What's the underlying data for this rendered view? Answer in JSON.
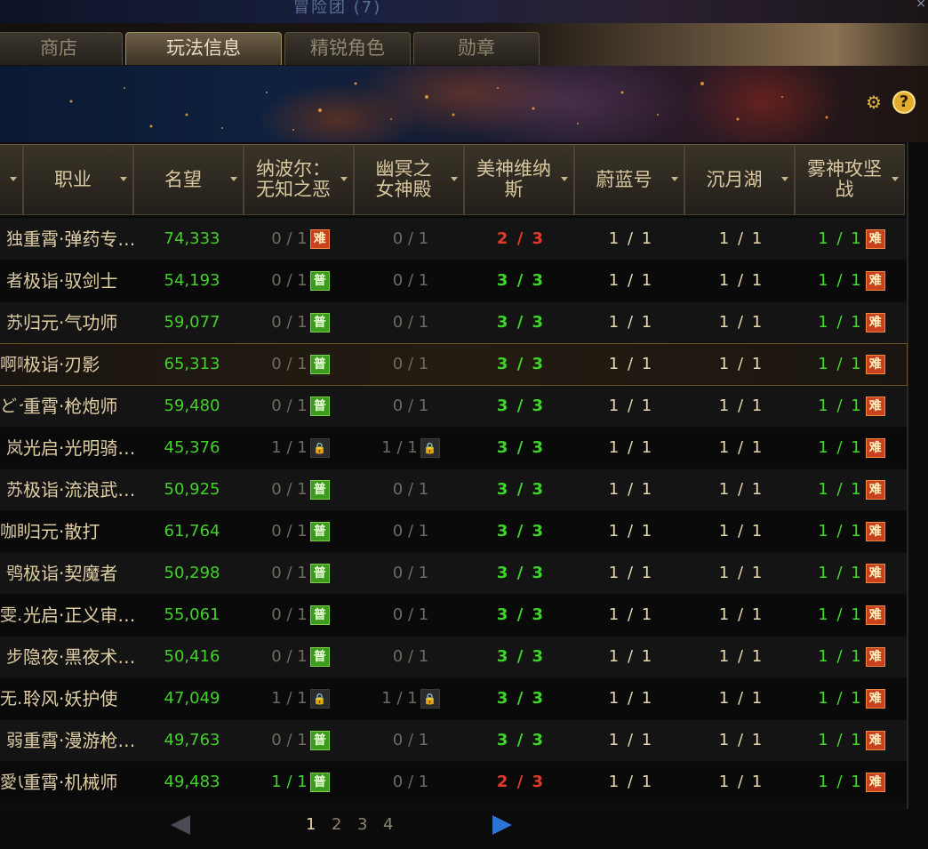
{
  "window": {
    "title": "冒险团 (7)",
    "close_glyph": "×"
  },
  "tabs": [
    {
      "label": "商店",
      "active": false
    },
    {
      "label": "玩法信息",
      "active": true
    },
    {
      "label": "精锐角色",
      "active": false
    },
    {
      "label": "勋章",
      "active": false
    }
  ],
  "toolbar": {
    "settings_icon": "gear-icon",
    "help_icon": "help-icon",
    "help_glyph": "?"
  },
  "table": {
    "headers": {
      "name": "",
      "job": "职业",
      "fame": "名望",
      "nabol": "纳波尔：\n无知之恶",
      "youming": "幽冥之\n女神殿",
      "meishen": "美神维纳\n斯",
      "weilan": "蔚蓝号",
      "chenyue": "沉月湖",
      "wushen": "雾神攻坚\n战"
    },
    "rows": [
      {
        "name": "独",
        "job": "重霄·弹药专…",
        "fame": "74,333",
        "nabol": "0 / 1",
        "nabol_badge": "难",
        "youming": "0 / 1",
        "youming_badge": "",
        "meishen": "2 / 3",
        "weilan": "1 / 1",
        "chenyue": "1 / 1",
        "wushen": "1 / 1",
        "wushen_badge": "难"
      },
      {
        "name": "者",
        "job": "极诣·驭剑士",
        "fame": "54,193",
        "nabol": "0 / 1",
        "nabol_badge": "普",
        "youming": "0 / 1",
        "youming_badge": "",
        "meishen": "3 / 3",
        "weilan": "1 / 1",
        "chenyue": "1 / 1",
        "wushen": "1 / 1",
        "wushen_badge": "难"
      },
      {
        "name": "苏",
        "job": "归元·气功师",
        "fame": "59,077",
        "nabol": "0 / 1",
        "nabol_badge": "普",
        "youming": "0 / 1",
        "youming_badge": "",
        "meishen": "3 / 3",
        "weilan": "1 / 1",
        "chenyue": "1 / 1",
        "wushen": "1 / 1",
        "wushen_badge": "难"
      },
      {
        "name": "啊啊",
        "job": "极诣·刃影",
        "fame": "65,313",
        "nabol": "0 / 1",
        "nabol_badge": "普",
        "youming": "0 / 1",
        "youming_badge": "",
        "meishen": "3 / 3",
        "weilan": "1 / 1",
        "chenyue": "1 / 1",
        "wushen": "1 / 1",
        "wushen_badge": "难"
      },
      {
        "name": "どっ",
        "job": "重霄·枪炮师",
        "fame": "59,480",
        "nabol": "0 / 1",
        "nabol_badge": "普",
        "youming": "0 / 1",
        "youming_badge": "",
        "meishen": "3 / 3",
        "weilan": "1 / 1",
        "chenyue": "1 / 1",
        "wushen": "1 / 1",
        "wushen_badge": "难"
      },
      {
        "name": "岚",
        "job": "光启·光明骑…",
        "fame": "45,376",
        "nabol": "1 / 1",
        "nabol_badge": "lock",
        "youming": "1 / 1",
        "youming_badge": "lock",
        "meishen": "3 / 3",
        "weilan": "1 / 1",
        "chenyue": "1 / 1",
        "wushen": "1 / 1",
        "wushen_badge": "难"
      },
      {
        "name": "苏",
        "job": "极诣·流浪武…",
        "fame": "50,925",
        "nabol": "0 / 1",
        "nabol_badge": "普",
        "youming": "0 / 1",
        "youming_badge": "",
        "meishen": "3 / 3",
        "weilan": "1 / 1",
        "chenyue": "1 / 1",
        "wushen": "1 / 1",
        "wushen_badge": "难"
      },
      {
        "name": "咖眸",
        "job": "归元·散打",
        "fame": "61,764",
        "nabol": "0 / 1",
        "nabol_badge": "普",
        "youming": "0 / 1",
        "youming_badge": "",
        "meishen": "3 / 3",
        "weilan": "1 / 1",
        "chenyue": "1 / 1",
        "wushen": "1 / 1",
        "wushen_badge": "难"
      },
      {
        "name": "鸮",
        "job": "极诣·契魔者",
        "fame": "50,298",
        "nabol": "0 / 1",
        "nabol_badge": "普",
        "youming": "0 / 1",
        "youming_badge": "",
        "meishen": "3 / 3",
        "weilan": "1 / 1",
        "chenyue": "1 / 1",
        "wushen": "1 / 1",
        "wushen_badge": "难"
      },
      {
        "name": "雯…",
        "job": "光启·正义审…",
        "fame": "55,061",
        "nabol": "0 / 1",
        "nabol_badge": "普",
        "youming": "0 / 1",
        "youming_badge": "",
        "meishen": "3 / 3",
        "weilan": "1 / 1",
        "chenyue": "1 / 1",
        "wushen": "1 / 1",
        "wushen_badge": "难"
      },
      {
        "name": "步",
        "job": "隐夜·黑夜术…",
        "fame": "50,416",
        "nabol": "0 / 1",
        "nabol_badge": "普",
        "youming": "0 / 1",
        "youming_badge": "",
        "meishen": "3 / 3",
        "weilan": "1 / 1",
        "chenyue": "1 / 1",
        "wushen": "1 / 1",
        "wushen_badge": "难"
      },
      {
        "name": "无…",
        "job": "聆风·妖护使",
        "fame": "47,049",
        "nabol": "1 / 1",
        "nabol_badge": "lock",
        "youming": "1 / 1",
        "youming_badge": "lock",
        "meishen": "3 / 3",
        "weilan": "1 / 1",
        "chenyue": "1 / 1",
        "wushen": "1 / 1",
        "wushen_badge": "难"
      },
      {
        "name": "弱",
        "job": "重霄·漫游枪…",
        "fame": "49,763",
        "nabol": "0 / 1",
        "nabol_badge": "普",
        "youming": "0 / 1",
        "youming_badge": "",
        "meishen": "3 / 3",
        "weilan": "1 / 1",
        "chenyue": "1 / 1",
        "wushen": "1 / 1",
        "wushen_badge": "难"
      },
      {
        "name": "愛い",
        "job": "重霄·机械师",
        "fame": "49,483",
        "nabol": "1 / 1",
        "nabol_badge": "普",
        "youming": "0 / 1",
        "youming_badge": "",
        "meishen": "2 / 3",
        "weilan": "1 / 1",
        "chenyue": "1 / 1",
        "wushen": "1 / 1",
        "wushen_badge": "难"
      }
    ]
  },
  "pagination": {
    "pages": [
      "1",
      "2",
      "3",
      "4"
    ],
    "current": "1"
  },
  "colors": {
    "accent_green": "#3ed52b",
    "warn_red": "#e23a2a",
    "hard_badge": "#c8401c",
    "normal_badge": "#3c9b1e",
    "next_arrow": "#2b73d6"
  }
}
